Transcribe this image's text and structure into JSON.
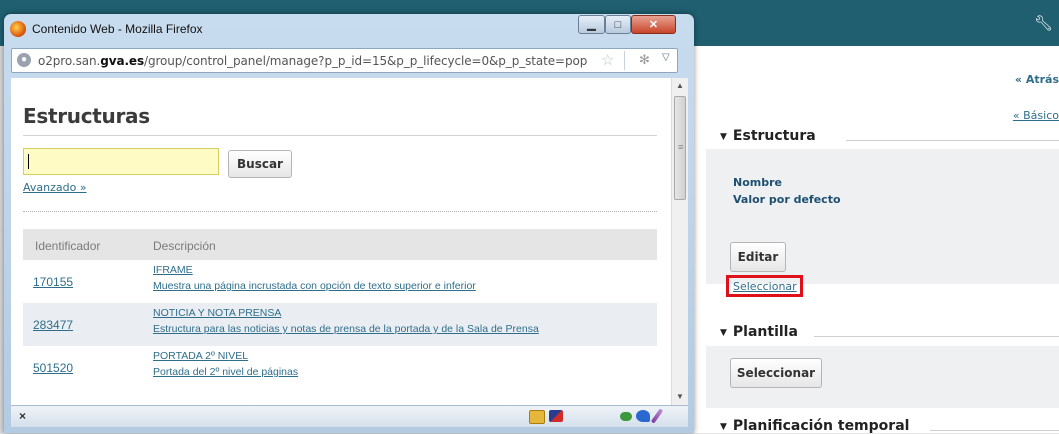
{
  "background_app": {
    "atras_link": "« Atrás",
    "basico_link": "« Básico",
    "estructura_section": {
      "title": "Estructura",
      "nombre_label": "Nombre",
      "valor_label": "Valor por defecto",
      "editar_button": "Editar",
      "seleccionar_link": "Seleccionar"
    },
    "plantilla_section": {
      "title": "Plantilla",
      "seleccionar_button": "Seleccionar"
    },
    "planificacion_section": {
      "title": "Planificación temporal"
    },
    "accent_color": "#1f5f70",
    "highlight_color": "#e0101b"
  },
  "popup": {
    "window_title": "Contenido Web - Mozilla Firefox",
    "url_prefix": "o2pro.san.",
    "url_domain": "gva.es",
    "url_suffix": "/group/control_panel/manage?p_p_id=15&p_p_lifecycle=0&p_p_state=pop",
    "page_title": "Estructuras",
    "search": {
      "value": "",
      "button": "Buscar",
      "advanced_link": "Avanzado »"
    },
    "table": {
      "headers": [
        "Identificador",
        "Descripción"
      ],
      "rows": [
        {
          "id": "170155",
          "name": "IFRAME",
          "description": "Muestra una página incrustada con opción de texto superior e inferior"
        },
        {
          "id": "283477",
          "name": "NOTICIA Y NOTA PRENSA",
          "description": "Estructura para las noticias y notas de prensa de la portada y de la Sala de Prensa"
        },
        {
          "id": "501520",
          "name": "PORTADA 2º NIVEL",
          "description": "Portada del 2º nivel de páginas"
        }
      ]
    },
    "statusbar": {
      "close_label": "×"
    }
  }
}
